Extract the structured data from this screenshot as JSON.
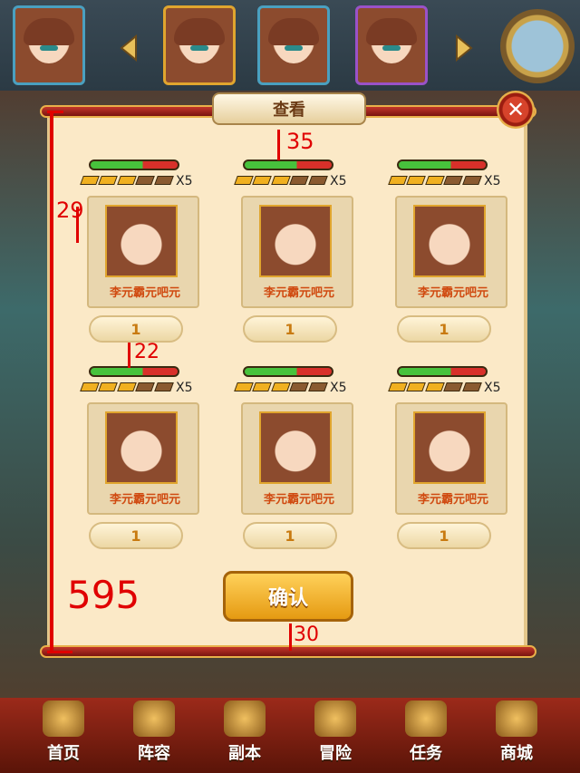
{
  "title": "查看",
  "close": "✕",
  "confirm_label": "确认",
  "cards": [
    {
      "name": "李元霸元吧元",
      "multiplier": "X5",
      "count": "1",
      "hp_fraction": 0.6,
      "stars_on": 3,
      "stars_total": 5
    },
    {
      "name": "李元霸元吧元",
      "multiplier": "X5",
      "count": "1",
      "hp_fraction": 0.6,
      "stars_on": 3,
      "stars_total": 5
    },
    {
      "name": "李元霸元吧元",
      "multiplier": "X5",
      "count": "1",
      "hp_fraction": 0.6,
      "stars_on": 3,
      "stars_total": 5
    },
    {
      "name": "李元霸元吧元",
      "multiplier": "X5",
      "count": "1",
      "hp_fraction": 0.6,
      "stars_on": 3,
      "stars_total": 5
    },
    {
      "name": "李元霸元吧元",
      "multiplier": "X5",
      "count": "1",
      "hp_fraction": 0.6,
      "stars_on": 3,
      "stars_total": 5
    },
    {
      "name": "李元霸元吧元",
      "multiplier": "X5",
      "count": "1",
      "hp_fraction": 0.6,
      "stars_on": 3,
      "stars_total": 5
    }
  ],
  "annotations": {
    "a35": "35",
    "a29": "29",
    "a22": "22",
    "a595": "595",
    "a30": "30"
  },
  "nav": [
    {
      "label": "首页",
      "icon": "home-icon"
    },
    {
      "label": "阵容",
      "icon": "formation-icon"
    },
    {
      "label": "副本",
      "icon": "dungeon-icon"
    },
    {
      "label": "冒险",
      "icon": "adventure-icon"
    },
    {
      "label": "任务",
      "icon": "quest-icon"
    },
    {
      "label": "商城",
      "icon": "shop-icon"
    }
  ],
  "colors": {
    "accent": "#e59a12",
    "hp_green": "#47c23c",
    "hp_red": "#d8302a",
    "annotation": "#e00000"
  }
}
